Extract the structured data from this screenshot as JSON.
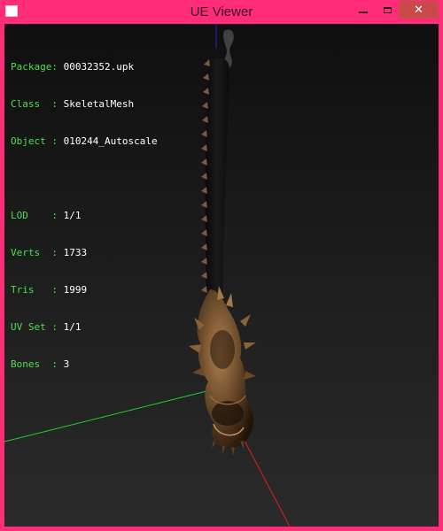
{
  "window": {
    "title": "UE Viewer",
    "controls": {
      "minimize": "minimize",
      "maximize": "maximize",
      "close": "close"
    },
    "frame_color": "#ff2d78"
  },
  "info": {
    "object_rows": [
      {
        "key": "Package",
        "sep": ": ",
        "value": "00032352.upk"
      },
      {
        "key": "Class  ",
        "sep": ": ",
        "value": "SkeletalMesh"
      },
      {
        "key": "Object ",
        "sep": ": ",
        "value": "010244_Autoscale"
      }
    ],
    "mesh_rows": [
      {
        "key": "LOD    ",
        "sep": ": ",
        "value": "1/1"
      },
      {
        "key": "Verts  ",
        "sep": ": ",
        "value": "1733"
      },
      {
        "key": "Tris   ",
        "sep": ": ",
        "value": "1999"
      },
      {
        "key": "UV Set ",
        "sep": ": ",
        "value": "1/1"
      },
      {
        "key": "Bones  ",
        "sep": ": ",
        "value": "3"
      }
    ],
    "key_color": "#4ae04a",
    "value_color": "#ffffff"
  },
  "axes": {
    "x_color": "#e02020",
    "y_color": "#20d020",
    "z_color": "#2020d0"
  }
}
